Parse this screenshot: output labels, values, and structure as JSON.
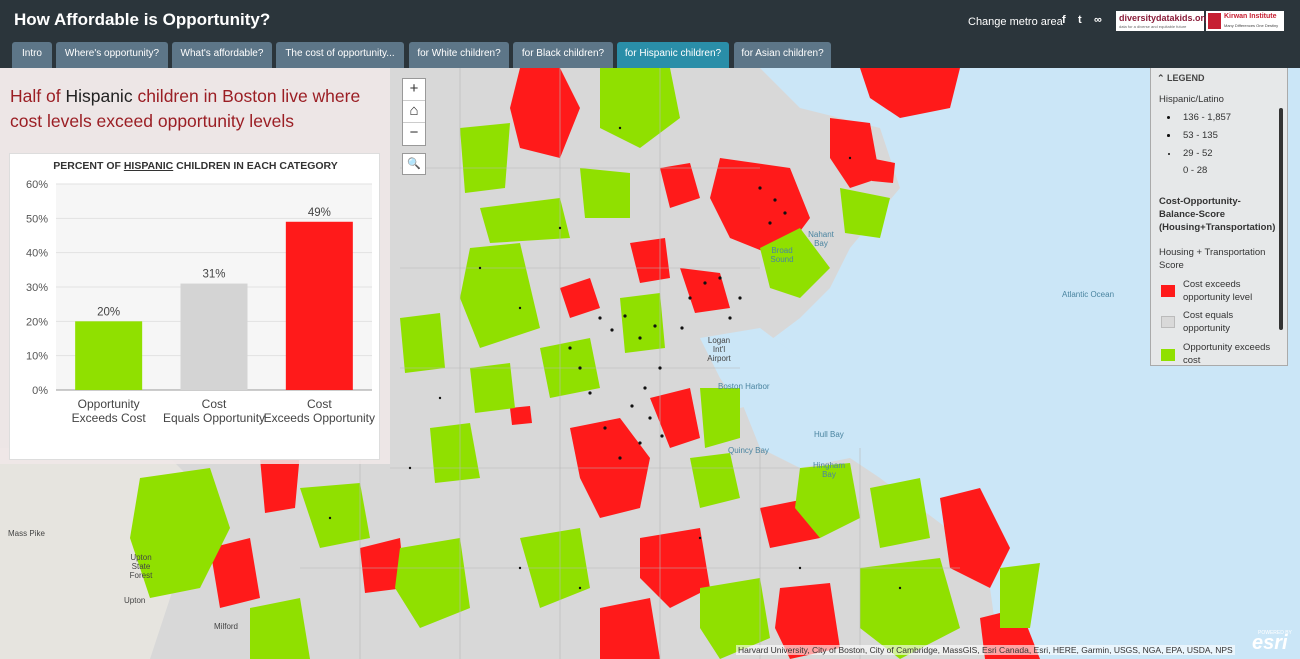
{
  "app": {
    "title": "How Affordable is Opportunity?",
    "change_metro": "Change metro area",
    "social": {
      "facebook": "f",
      "twitter": "t",
      "link": "∞"
    },
    "logos": {
      "ddk": "diversitydatakids.org",
      "ddk_tag": "data for a diverse and equitable future",
      "kirwan": "Kirwan Institute",
      "kirwan_tag": "Many Differences One Destiny"
    }
  },
  "tabs": [
    {
      "label": "Intro"
    },
    {
      "label": "Where's opportunity?"
    },
    {
      "label": "What's affordable?"
    },
    {
      "label": "The cost of opportunity..."
    },
    {
      "label": "for White children?"
    },
    {
      "label": "for Black children?"
    },
    {
      "label": "for Hispanic children?"
    },
    {
      "label": "for Asian children?"
    }
  ],
  "headline": {
    "pre": "Half of ",
    "highlight": "Hispanic",
    "post": " children in Boston live where cost levels exceed opportunity levels"
  },
  "chart_data": {
    "type": "bar",
    "title_pre": "PERCENT OF ",
    "title_highlight": "HISPANIC",
    "title_post": " CHILDREN IN EACH CATEGORY",
    "categories": [
      "Opportunity Exceeds Cost",
      "Cost Equals Opportunity",
      "Cost Exceeds Opportunity"
    ],
    "values": [
      20,
      31,
      49
    ],
    "value_labels": [
      "20%",
      "31%",
      "49%"
    ],
    "colors": [
      "#90e000",
      "#d4d4d4",
      "#ff1a1a"
    ],
    "ylim": [
      0,
      60
    ],
    "yticks": [
      0,
      10,
      20,
      30,
      40,
      50,
      60
    ],
    "ytick_labels": [
      "0%",
      "10%",
      "20%",
      "30%",
      "40%",
      "50%",
      "60%"
    ]
  },
  "map_controls": {
    "zoom_in": "+",
    "home": "⌂",
    "zoom_out": "−",
    "search": "🔍"
  },
  "legend": {
    "title": "LEGEND",
    "layer1": "Hispanic/Latino",
    "dot_classes": [
      "136 - 1,857",
      "53 - 135",
      "29 - 52",
      "0 - 28"
    ],
    "layer2": "Cost-Opportunity-Balance-Score (Housing+Transportation)",
    "layer2_sub": "Housing + Transportation Score",
    "classes": [
      {
        "label": "Cost exceeds opportunity level",
        "color": "#ff1a1a"
      },
      {
        "label": "Cost equals opportunity",
        "color": "#d9d9d9"
      },
      {
        "label": "Opportunity exceeds cost",
        "color": "#90e000"
      }
    ]
  },
  "map_labels": {
    "atlantic": "Atlantic Ocean",
    "nahant": "Nahant Bay",
    "broad": "Broad Sound",
    "logan": "Logan Int'l Airport",
    "harbor": "Boston Harbor",
    "quincy": "Quincy Bay",
    "hull": "Hull Bay",
    "hingham": "Hingham Bay",
    "mass_pike": "Mass Pike",
    "upton_forest": "Upton State Forest",
    "upton": "Upton",
    "milford": "Milford"
  },
  "attribution": "Harvard University, City of Boston, City of Cambridge, MassGIS, Esri Canada, Esri, HERE, Garmin, USGS, NGA, EPA, USDA, NPS",
  "esri": "esri",
  "esri_small": "POWERED BY"
}
